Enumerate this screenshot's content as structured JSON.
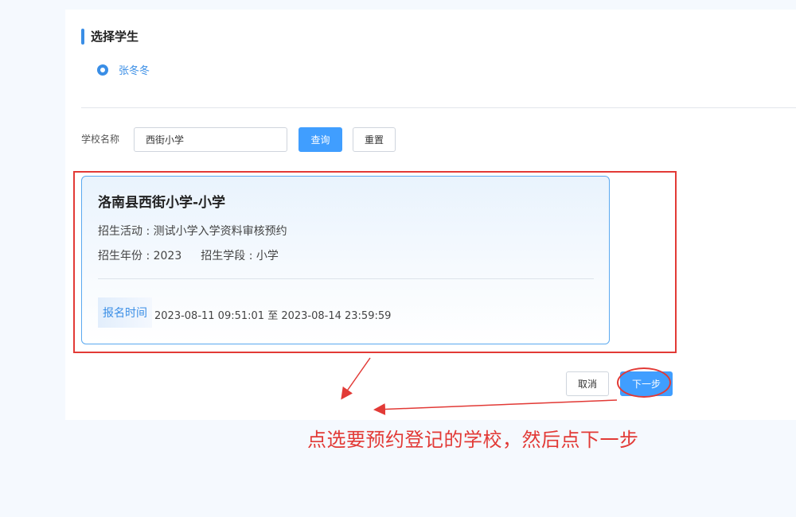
{
  "section": {
    "title": "选择学生"
  },
  "student": {
    "name": "张冬冬",
    "selected": true
  },
  "search": {
    "label": "学校名称",
    "value": "西街小学",
    "query_label": "查询",
    "reset_label": "重置"
  },
  "school_card": {
    "name": "洛南县西街小学-小学",
    "activity": "招生活动 : 测试小学入学资料审核预约",
    "year": "招生年份 : 2023",
    "stage": "招生学段 : 小学",
    "reg_tag": "报名时间",
    "reg_time": "2023-08-11 09:51:01 至 2023-08-14 23:59:59"
  },
  "footer": {
    "cancel_label": "取消",
    "next_label": "下一步"
  },
  "annotation": {
    "text": "点选要预约登记的学校，然后点下一步",
    "color": "#e23a36"
  },
  "colors": {
    "accent": "#409eff",
    "page_bg": "#f5f9fe"
  }
}
